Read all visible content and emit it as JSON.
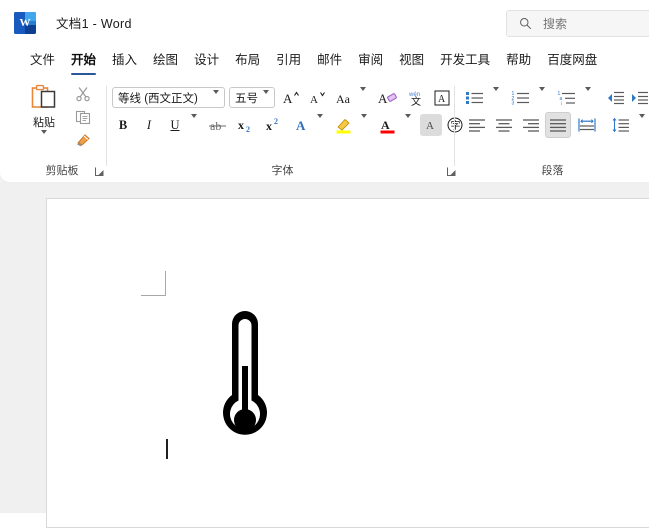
{
  "window": {
    "app_name": "Word",
    "document_title": "文档1",
    "title_separator": "-",
    "logo_letter": "W",
    "logo_color": "#185abd"
  },
  "search": {
    "placeholder": "搜索",
    "icon": "search-icon"
  },
  "tabs": [
    {
      "label": "文件",
      "active": false
    },
    {
      "label": "开始",
      "active": true
    },
    {
      "label": "插入",
      "active": false
    },
    {
      "label": "绘图",
      "active": false
    },
    {
      "label": "设计",
      "active": false
    },
    {
      "label": "布局",
      "active": false
    },
    {
      "label": "引用",
      "active": false
    },
    {
      "label": "邮件",
      "active": false
    },
    {
      "label": "审阅",
      "active": false
    },
    {
      "label": "视图",
      "active": false
    },
    {
      "label": "开发工具",
      "active": false
    },
    {
      "label": "帮助",
      "active": false
    },
    {
      "label": "百度网盘",
      "active": false
    }
  ],
  "ribbon": {
    "accent_color": "#2b579a",
    "clipboard": {
      "group_label": "剪贴板",
      "paste_label": "粘贴",
      "paste_icon": "paste-icon",
      "cut_icon": "scissors-icon",
      "copy_icon": "copy-icon",
      "format_painter_icon": "format-painter-icon",
      "dialog_launcher_icon": "dialog-launcher-icon"
    },
    "font": {
      "group_label": "字体",
      "font_name": "等线 (西文正文)",
      "font_size": "五号",
      "grow_font_icon": "grow-font-icon",
      "shrink_font_icon": "shrink-font-icon",
      "change_case_icon": "change-case-icon",
      "clear_formatting_icon": "clear-formatting-icon",
      "phonetic_guide_icon": "phonetic-guide-icon",
      "character_border_icon": "character-border-icon",
      "bold_label": "B",
      "italic_label": "I",
      "underline_label": "U",
      "strikethrough_icon": "strikethrough-icon",
      "subscript_label": "x",
      "subscript_sup": "2",
      "superscript_label": "x",
      "superscript_sup": "2",
      "text_effects_icon": "text-effects-icon",
      "highlight_icon": "highlight-color-icon",
      "highlight_color": "#ffff00",
      "font_color_icon": "font-color-icon",
      "font_color": "#ff0000",
      "shading_icon": "character-shading-icon",
      "enclose_characters_icon": "enclose-characters-icon",
      "dialog_launcher_icon": "dialog-launcher-icon"
    },
    "paragraph": {
      "group_label": "段落",
      "bullets_icon": "bullets-icon",
      "numbering_icon": "numbering-icon",
      "multilevel_icon": "multilevel-list-icon",
      "decrease_indent_icon": "decrease-indent-icon",
      "increase_indent_icon": "increase-indent-icon",
      "align_left_icon": "align-left-icon",
      "align_center_icon": "align-center-icon",
      "align_right_icon": "align-right-icon",
      "justify_icon": "justify-icon",
      "justify_selected": true,
      "distribute_icon": "distribute-text-icon",
      "line_spacing_icon": "line-spacing-icon"
    }
  },
  "document": {
    "content_symbol": "🌡",
    "content_symbol_name": "thermometer-glyph",
    "margin_mark_name": "margin-corner-mark",
    "caret_name": "text-caret",
    "page_background": "#ffffff",
    "canvas_background": "#f0f0f0"
  }
}
